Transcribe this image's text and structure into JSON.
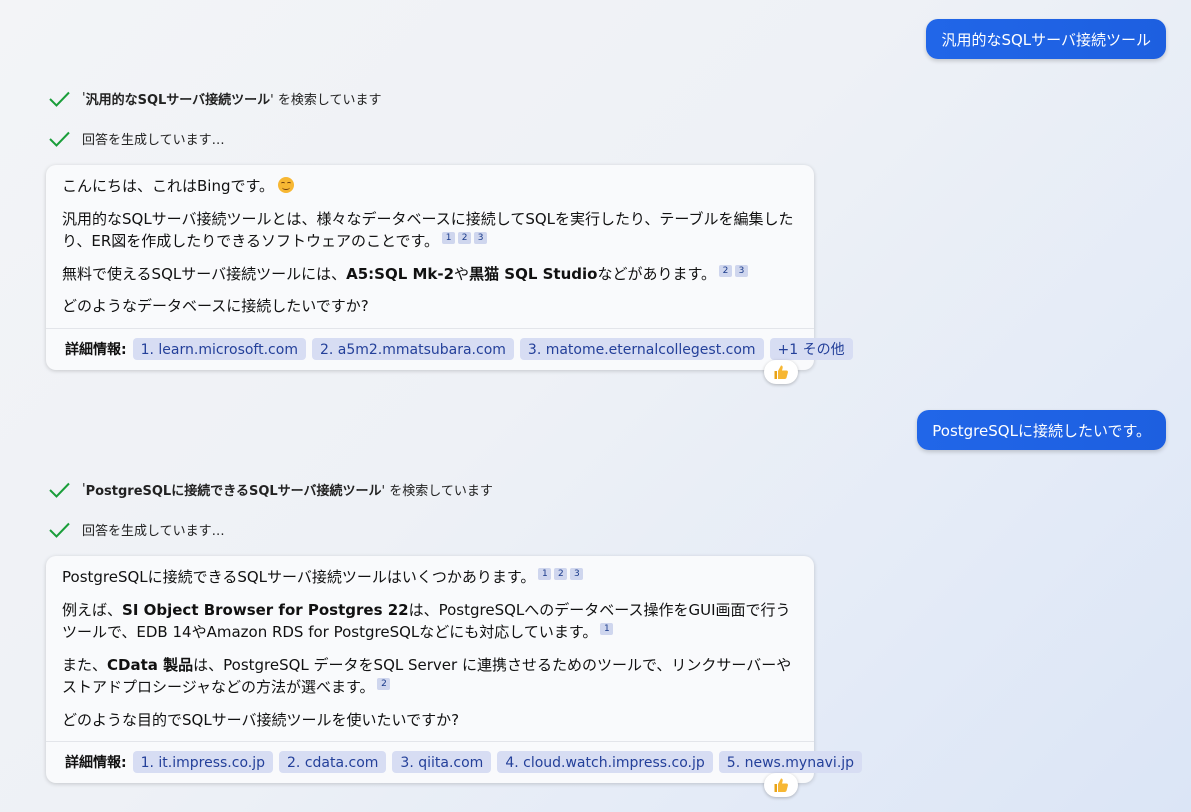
{
  "conversation": {
    "user_msg_1": "汎用的なSQLサーバ接続ツール",
    "turn1": {
      "search_query": "汎用的なSQLサーバ接続ツール",
      "search_prefix": "'",
      "search_suffix": "' を検索しています",
      "generating": "回答を生成しています…",
      "p1": "こんにちは、これはBingです。",
      "p2": "汎用的なSQLサーバ接続ツールとは、様々なデータベースに接続してSQLを実行したり、テーブルを編集したり、ER図を作成したりできるソフトウェアのことです。",
      "p3_a": "無料で使えるSQLサーバ接続ツールには、",
      "p3_b1": "A5:SQL Mk-2",
      "p3_c": "や",
      "p3_b2": "黒猫 SQL Studio",
      "p3_d": "などがあります。",
      "p4": "どのようなデータベースに接続したいですか?",
      "refs_label": "詳細情報:",
      "refs": [
        "1. learn.microsoft.com",
        "2. a5m2.mmatsubara.com",
        "3. matome.eternalcollegest.com",
        "+1 その他"
      ]
    },
    "user_msg_2": "PostgreSQLに接続したいです。",
    "turn2": {
      "search_query": "PostgreSQLに接続できるSQLサーバ接続ツール",
      "search_prefix": "'",
      "search_suffix": "' を検索しています",
      "generating": "回答を生成しています…",
      "p1": "PostgreSQLに接続できるSQLサーバ接続ツールはいくつかあります。",
      "p2_a": "例えば、",
      "p2_b": "SI Object Browser for Postgres 22",
      "p2_c": "は、PostgreSQLへのデータベース操作をGUI画面で行うツールで、EDB 14やAmazon RDS for PostgreSQLなどにも対応しています。",
      "p3_a": "また、",
      "p3_b": "CData 製品",
      "p3_c": "は、PostgreSQL データをSQL Server に連携させるためのツールで、リンクサーバーやストアドプロシージャなどの方法が選べます。",
      "p4": "どのような目的でSQLサーバ接続ツールを使いたいですか?",
      "refs_label": "詳細情報:",
      "refs": [
        "1. it.impress.co.jp",
        "2. cdata.com",
        "3. qiita.com",
        "4. cloud.watch.impress.co.jp",
        "5. news.mynavi.jp"
      ]
    },
    "cites": {
      "c1": "1",
      "c2": "2",
      "c3": "3"
    }
  },
  "colors": {
    "accent": "#1d62e6",
    "chip_bg": "#d7ddf3",
    "check": "#1a9e3a"
  },
  "icons": {
    "check": "check-icon",
    "like": "thumbs-up-icon",
    "emoji": "smiling-face-icon"
  }
}
